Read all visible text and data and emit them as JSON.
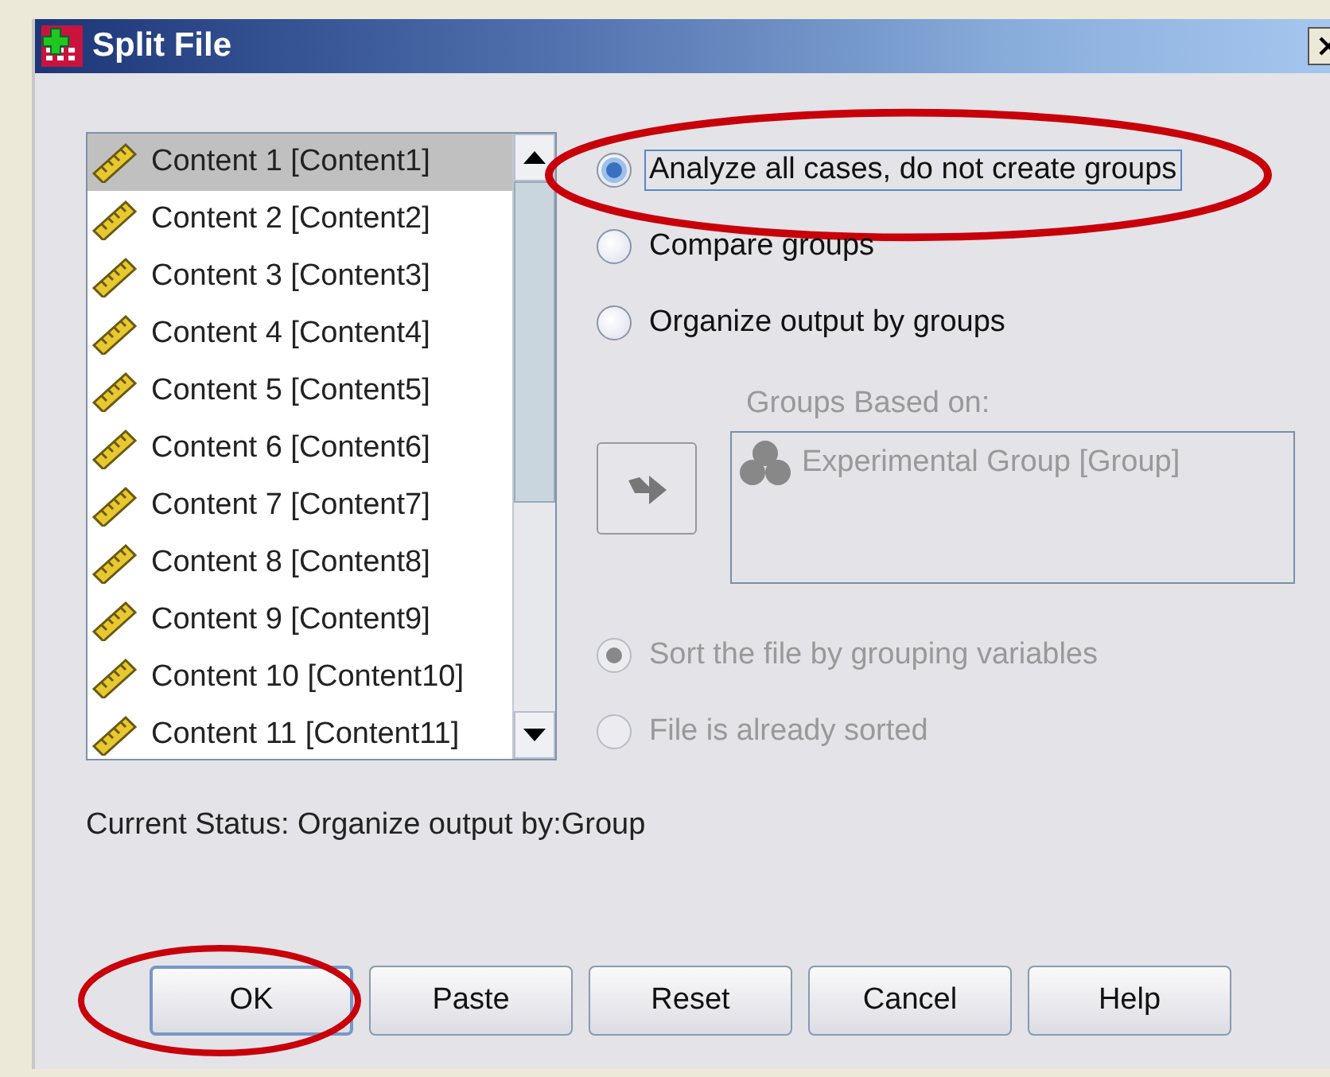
{
  "window": {
    "title": "Split File"
  },
  "variables": [
    {
      "label": "Content 1 [Content1]",
      "selected": true
    },
    {
      "label": "Content 2 [Content2]",
      "selected": false
    },
    {
      "label": "Content 3 [Content3]",
      "selected": false
    },
    {
      "label": "Content 4 [Content4]",
      "selected": false
    },
    {
      "label": "Content 5 [Content5]",
      "selected": false
    },
    {
      "label": "Content 6 [Content6]",
      "selected": false
    },
    {
      "label": "Content 7 [Content7]",
      "selected": false
    },
    {
      "label": "Content 8 [Content8]",
      "selected": false
    },
    {
      "label": "Content 9 [Content9]",
      "selected": false
    },
    {
      "label": "Content 10 [Content10]",
      "selected": false
    },
    {
      "label": "Content 11 [Content11]",
      "selected": false
    }
  ],
  "mode_options": [
    {
      "label": "Analyze all cases, do not create groups",
      "selected": true,
      "highlighted": true
    },
    {
      "label": "Compare groups",
      "selected": false,
      "highlighted": false
    },
    {
      "label": "Organize output by groups",
      "selected": false,
      "highlighted": false
    }
  ],
  "groups_based_on": {
    "label": "Groups Based on:",
    "disabled": true,
    "items": [
      "Experimental Group [Group]"
    ]
  },
  "sort_options": [
    {
      "label": "Sort the file by grouping variables",
      "selected": true,
      "disabled": true
    },
    {
      "label": "File is already sorted",
      "selected": false,
      "disabled": true
    }
  ],
  "status": "Current Status: Organize output by:Group",
  "buttons": [
    {
      "label": "OK",
      "default": true,
      "highlighted": true
    },
    {
      "label": "Paste",
      "default": false,
      "highlighted": false
    },
    {
      "label": "Reset",
      "default": false,
      "highlighted": false
    },
    {
      "label": "Cancel",
      "default": false,
      "highlighted": false
    },
    {
      "label": "Help",
      "default": false,
      "highlighted": false
    }
  ]
}
